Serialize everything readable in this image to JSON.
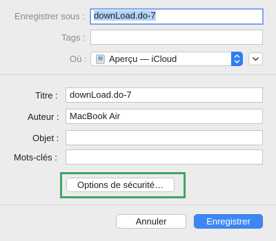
{
  "save_as": {
    "label": "Enregistrer sous :",
    "value": "downLoad.do-7"
  },
  "tags": {
    "label": "Tags :",
    "value": ""
  },
  "where": {
    "label": "Où :",
    "value": "Aperçu — iCloud",
    "icon": "preview-app-icon"
  },
  "properties": {
    "title": {
      "label": "Titre :",
      "value": "downLoad.do-7"
    },
    "author": {
      "label": "Auteur :",
      "value": "MacBook Air"
    },
    "subject": {
      "label": "Objet :",
      "value": ""
    },
    "keywords": {
      "label": "Mots-clés :",
      "value": ""
    }
  },
  "security_button": {
    "label": "Options de sécurité…"
  },
  "footer": {
    "cancel_label": "Annuler",
    "save_label": "Enregistrer"
  },
  "colors": {
    "accent": "#3d87f5",
    "highlight_box": "#3fa464",
    "selection": "#b4d3fb"
  }
}
